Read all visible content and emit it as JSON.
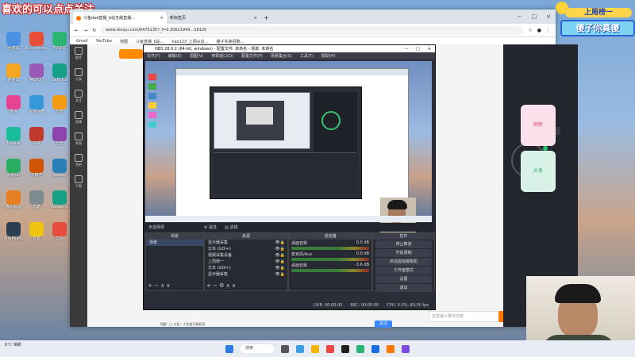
{
  "overlay": {
    "top_left_banner": "喜欢的可以点点关注",
    "top_right_badge_line1": "上周榜一",
    "top_right_badge_line2": "傻子你真傻"
  },
  "desktop_icons": [
    {
      "label": "回收站"
    },
    {
      "label": "Everything"
    },
    {
      "label": "EV录屏"
    },
    {
      "label": "网易云"
    },
    {
      "label": "腾讯QQ"
    },
    {
      "label": "GeForce"
    },
    {
      "label": "微信"
    },
    {
      "label": "百度网盘"
    },
    {
      "label": "吾爱"
    },
    {
      "label": "ToDesk"
    },
    {
      "label": "火绒"
    },
    {
      "label": "迅雷"
    },
    {
      "label": "网易UU"
    },
    {
      "label": "爱奇艺"
    },
    {
      "label": "Steam"
    },
    {
      "label": "腾讯会议"
    },
    {
      "label": "优酷"
    },
    {
      "label": "WeGame"
    },
    {
      "label": "网易MuMu"
    },
    {
      "label": "夸克"
    },
    {
      "label": "剪映"
    }
  ],
  "browser": {
    "tabs": [
      {
        "label": "斗鱼dad直播_b站无敌直播…"
      },
      {
        "label": "新标签页"
      }
    ],
    "url": "www.douyu.com/6475135?_f=0.30621949...18126",
    "bookmarks": [
      "Gmail",
      "YouTube",
      "地图",
      "斗鱼直播_b站...",
      "hao123_上网从这...",
      "爆子先锋招聘..."
    ]
  },
  "douyu": {
    "sidebar_items": [
      "推荐",
      "分类",
      "关注",
      "直播",
      "视频",
      "鱼吧",
      "下载"
    ],
    "stream_info": "【道】 □ 公告：人生若只如初见",
    "follow_button": "关注",
    "chat_placeholder": "这里输入聊天内容",
    "send_button": "发送",
    "panel_button": "退出",
    "start_live_label": "开始直播",
    "side_widgets": [
      "刷新",
      "头条",
      "活动"
    ]
  },
  "obs": {
    "title": "OBS 28.0.2 (64-bit, windows) - 配置文件: 未命名 - 场景: 未命名",
    "menu": [
      "文件(F)",
      "编辑(E)",
      "视图(V)",
      "停靠窗口(D)",
      "配置文件(P)",
      "场景集合(S)",
      "工具(T)",
      "帮助(H)"
    ],
    "status_bar": {
      "nosource": "未选择源",
      "props_button": "属性",
      "filter_button": "滤镜",
      "live": "LIVE: 00:00:00",
      "rec": "REC: 00:00:00",
      "cpu": "CPU: 0.0%, 60.00 fps"
    },
    "docks": {
      "scenes": {
        "title": "场景",
        "items": [
          "场景"
        ]
      },
      "sources": {
        "title": "来源",
        "items": [
          "显示器采集",
          "文本 (GDI+)",
          "视频采集设备",
          "上周榜一",
          "文本 (GDI+)",
          "显示器采集"
        ]
      },
      "mixer": {
        "title": "混音器",
        "tracks": [
          {
            "name": "桌面音频",
            "db": "0.0 dB"
          },
          {
            "name": "麦克风/Aux",
            "db": "0.0 dB"
          },
          {
            "name": "桌面音频",
            "db": "-3.6 dB"
          }
        ]
      },
      "controls": {
        "title": "控件",
        "buttons": [
          "停止推流",
          "开始录制",
          "启动虚拟摄像机",
          "工作室模式",
          "设置",
          "退出"
        ]
      }
    }
  },
  "taskbar": {
    "weather": "6°C 晴朗",
    "search_label": "搜索",
    "time": "23:09",
    "date": "2022/10/24"
  }
}
